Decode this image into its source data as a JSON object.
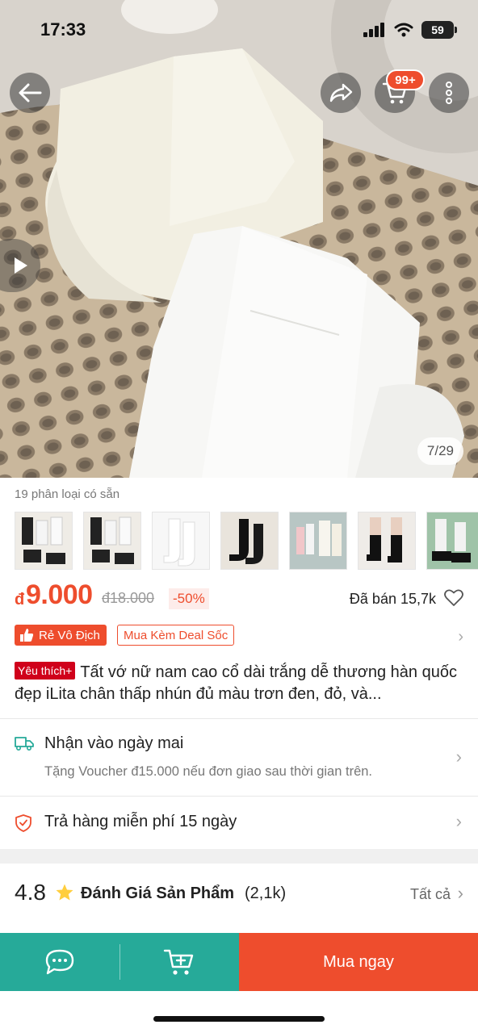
{
  "status_bar": {
    "time": "17:33",
    "battery": "59"
  },
  "gallery": {
    "counter": "7/29",
    "cart_badge": "99+"
  },
  "variants": {
    "label": "19 phân loại có sẵn",
    "thumb_count": 7
  },
  "price": {
    "currency": "đ",
    "current": "9.000",
    "original": "đ18.000",
    "discount": "-50%",
    "sold": "Đã bán 15,7k"
  },
  "tags": {
    "cheapest": "Rẻ Vô Địch",
    "deal": "Mua Kèm Deal Sốc"
  },
  "product": {
    "badge": "Yêu thích+",
    "title": "Tất vớ nữ nam cao cổ dài trắng dễ thương hàn quốc đẹp iLita chân thấp nhún đủ màu trơn đen, đỏ, và..."
  },
  "shipping": {
    "title": "Nhận vào ngày mai",
    "subtitle": "Tặng Voucher đ15.000 nếu đơn giao sau thời gian trên."
  },
  "returns": {
    "title": "Trả hàng miễn phí 15 ngày"
  },
  "rating": {
    "score": "4.8",
    "title": "Đánh Giá Sản Phẩm",
    "count": "(2,1k)",
    "see_all": "Tất cả"
  },
  "bottom_bar": {
    "buy_now": "Mua ngay"
  },
  "colors": {
    "accent": "#ee4d2d",
    "teal": "#26aa99",
    "favorite_badge": "#d0011b",
    "star": "#ffce3d"
  },
  "icons": [
    "back-arrow-icon",
    "share-icon",
    "cart-icon",
    "more-icon",
    "play-icon",
    "heart-icon",
    "truck-icon",
    "shield-icon",
    "star-icon",
    "chat-icon",
    "add-to-cart-icon"
  ]
}
